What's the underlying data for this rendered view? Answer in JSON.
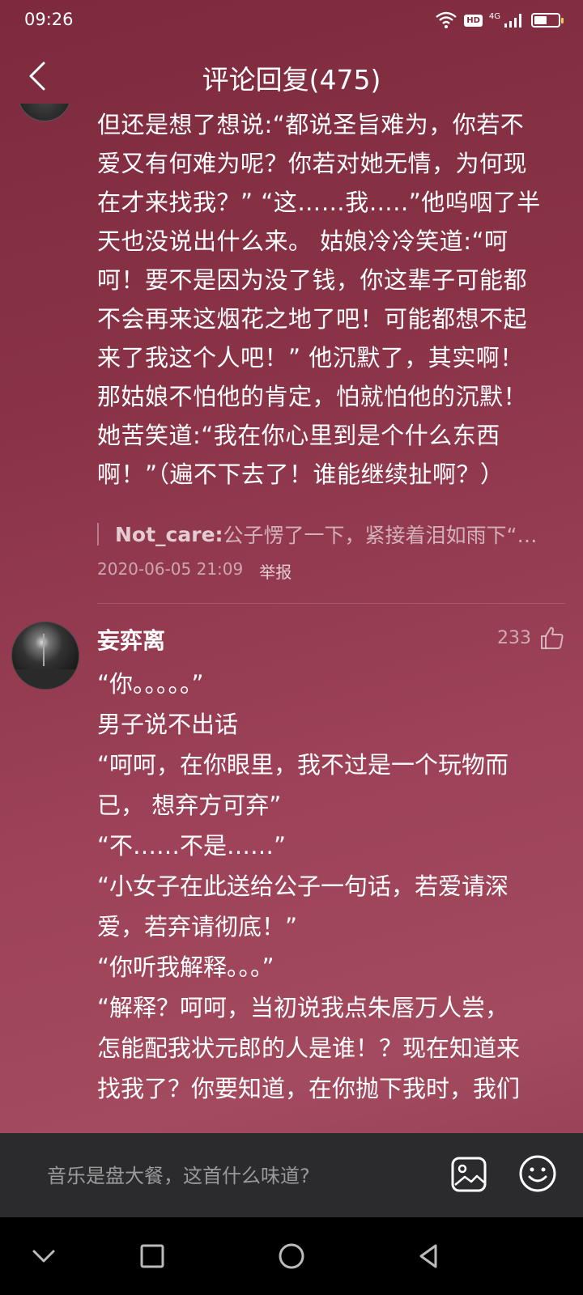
{
  "status_bar": {
    "time": "09:26",
    "hd_label": "HD",
    "network_label": "4G",
    "battery_percent": 55
  },
  "header": {
    "title": "评论回复(475)"
  },
  "comment1": {
    "lines": [
      "但还是想了想说:“都说圣旨难为，你若不",
      "爱又有何难为呢？你若对她无情，为何现",
      "在才来找我？”  “这……我…..”他呜咽了半",
      "天也没说出什么来。  姑娘冷冷笑道:“呵",
      "呵！要不是因为没了钱，你这辈子可能都",
      "不会再来这烟花之地了吧！可能都想不起",
      "来了我这个人吧！”  他沉默了，其实啊！",
      "那姑娘不怕他的肯定，怕就怕他的沉默！",
      "她苦笑道:“我在你心里到是个什么东西",
      "啊！”（遍不下去了！谁能继续扯啊？）"
    ],
    "reply_name": "Not_care:",
    "reply_text": " 公子愣了一下，紧接着泪如雨下“…",
    "timestamp": "2020-06-05 21:09",
    "report_label": "举报"
  },
  "comment2": {
    "username": "妄弈离",
    "like_count": "233",
    "lines": [
      "“你。。。。。”",
      "男子说不出话",
      "“呵呵，在你眼里，我不过是一个玩物而",
      "已， 想弃方可弃”",
      "“不……不是……”",
      "“小女子在此送给公子一句话，若爱请深",
      "爱，若弃请彻底！”",
      "“你听我解释。。。”",
      "“解释？呵呵，当初说我点朱唇万人尝，",
      "怎能配我状元郎的人是谁！？现在知道来",
      "找我了？你要知道，在你抛下我时，我们"
    ]
  },
  "input_bar": {
    "placeholder": "音乐是盘大餐，这首什么味道?"
  },
  "icons": {
    "back": "chevron-left-icon",
    "like": "thumbs-up-icon",
    "image": "image-icon",
    "emoji": "smiley-icon",
    "nav_back": "triangle-back-icon",
    "nav_home": "circle-home-icon",
    "nav_recent": "square-recent-icon",
    "nav_down": "chevron-down-icon"
  }
}
